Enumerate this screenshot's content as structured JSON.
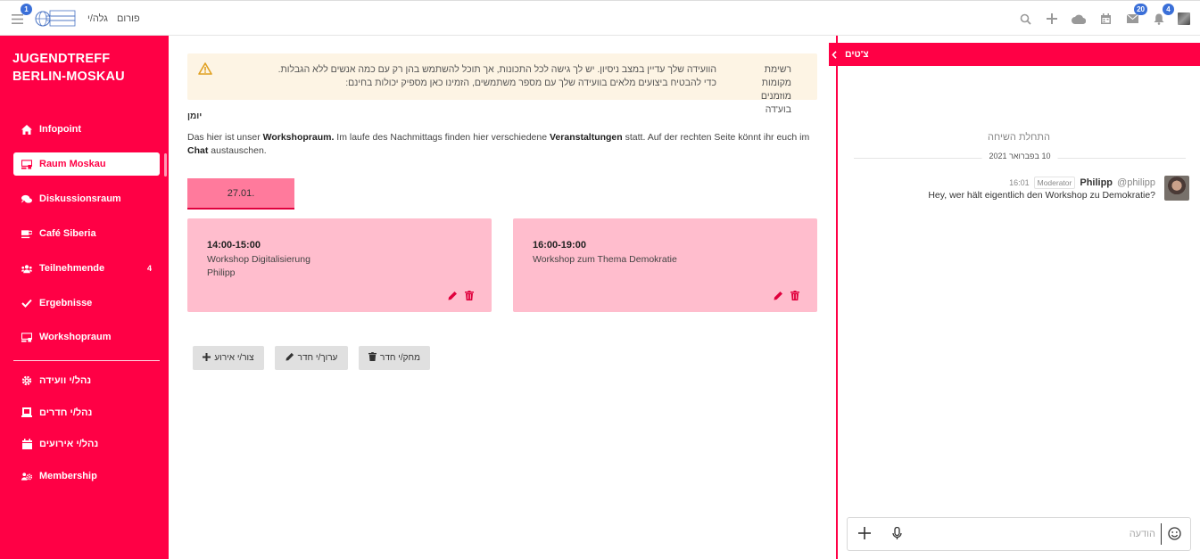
{
  "topbar": {
    "menu_badge": "1",
    "links": [
      "פורום",
      "גלה/י"
    ],
    "messages_badge": "20",
    "notifications_badge": "4"
  },
  "sidebar": {
    "title": "JUGENDTREFF BERLIN-MOSKAU",
    "items": [
      {
        "label": "Infopoint",
        "icon": "home-icon"
      },
      {
        "label": "Raum Moskau",
        "icon": "room-icon",
        "active": true
      },
      {
        "label": "Diskussionsraum",
        "icon": "comments-icon"
      },
      {
        "label": "Café Siberia",
        "icon": "coffee-icon"
      },
      {
        "label": "Teilnehmende",
        "icon": "users-icon",
        "count": "4"
      },
      {
        "label": "Ergebnisse",
        "icon": "check-icon"
      },
      {
        "label": "Workshopraum",
        "icon": "room-icon"
      }
    ],
    "admin_items": [
      {
        "label": "נהל/י וועידה",
        "icon": "gear-icon"
      },
      {
        "label": "נהל/י חדרים",
        "icon": "door-icon"
      },
      {
        "label": "נהל/י אירועים",
        "icon": "calendar-icon"
      },
      {
        "label": "Membership",
        "icon": "people-gear-icon"
      }
    ]
  },
  "warning": {
    "side_text": "רשימת מקומות מוזמנים בוע'דה",
    "text": "הוועידה שלך עדיין במצב ניסיון. יש לך גישה לכל התכונות, אך תוכל להשתמש בהן רק עם כמה אנשים ללא הגבלות. כדי להבטיח ביצועים מלאים בוועידה שלך עם מספר משתמשים, הזמינו כאן מספיק יכולות בחינם:"
  },
  "calendar_label": "יומן",
  "description": {
    "p1": "Das hier ist unser ",
    "b1": "Workshopraum.",
    "p2": " Im laufe des Nachmittags finden hier verschiedene ",
    "b2": "Veranstaltungen",
    "p3": " statt. Auf der rechten Seite könnt ihr euch im ",
    "b3": "Chat",
    "p4": " austauschen."
  },
  "day_tab": "27.01.",
  "events": [
    {
      "time": "14:00-15:00",
      "title": "Workshop Digitalisierung",
      "host": "Philipp"
    },
    {
      "time": "16:00-19:00",
      "title": "Workshop zum Thema Demokratie",
      "host": ""
    }
  ],
  "buttons": {
    "create_event": "צור/י אירוע",
    "edit_room": "ערוך/י חדר",
    "delete_room": "מחק/י חדר"
  },
  "chat": {
    "title": "צ'טים",
    "start_label": "התחלת השיחה",
    "date_label": "10 בפברואר 2021",
    "messages": [
      {
        "time": "16:01",
        "role": "Moderator",
        "user": "Philipp",
        "handle": "@philipp",
        "text": "Hey, wer hält eigentlich den Workshop zu Demokratie?"
      }
    ],
    "input_placeholder": "הודעה"
  },
  "colors": {
    "brand": "#ff0045",
    "card": "#ffbdcd",
    "tab": "#ff7a9c",
    "warning_bg": "#fdf4e4",
    "badge": "#3a6fd8"
  }
}
